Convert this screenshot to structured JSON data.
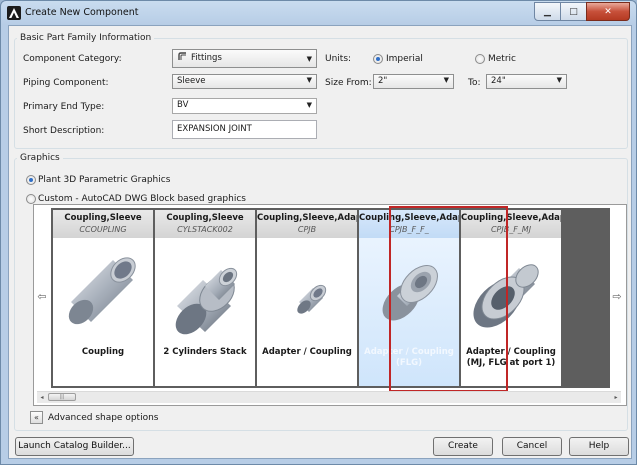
{
  "window": {
    "title": "Create New Component",
    "min_glyph": "▁",
    "max_glyph": "□",
    "close_glyph": "✕"
  },
  "basic_info": {
    "group_title": "Basic Part Family Information",
    "category_label": "Component Category:",
    "category_value": "Fittings",
    "units_label": "Units:",
    "unit_imperial": "Imperial",
    "unit_metric": "Metric",
    "units_selected": "Imperial",
    "piping_label": "Piping Component:",
    "piping_value": "Sleeve",
    "size_from_label": "Size From:",
    "size_from_value": "2\"",
    "to_label": "To:",
    "to_value": "24\"",
    "end_type_label": "Primary End Type:",
    "end_type_value": "BV",
    "short_desc_label": "Short Description:",
    "short_desc_value": "EXPANSION JOINT"
  },
  "graphics": {
    "group_title": "Graphics",
    "option_parametric": "Plant 3D Parametric Graphics",
    "option_custom": "Custom - AutoCAD DWG Block based graphics",
    "selected_option": "parametric",
    "cards": [
      {
        "family": "Coupling,Sleeve",
        "code": "CCOUPLING",
        "name": "Coupling",
        "shape": "coupling-cylinder-icon"
      },
      {
        "family": "Coupling,Sleeve",
        "code": "CYLSTACK002",
        "name": "2 Cylinders Stack",
        "shape": "cylinder-stack-icon"
      },
      {
        "family": "Coupling,Sleeve,Adapter",
        "code": "CPJB",
        "name": "Adapter / Coupling",
        "shape": "small-adapter-icon"
      },
      {
        "family": "Coupling,Sleeve,Adapter",
        "code": "CPJB_F_F_",
        "name": "Adapter / Coupling (FLG)",
        "shape": "flanged-adapter-icon"
      },
      {
        "family": "Coupling,Sleeve,Adapt",
        "code": "CPJB_F_MJ",
        "name": "Adapter / Coupling (MJ, FLG at port 1)",
        "shape": "flange-mj-adapter-icon"
      }
    ],
    "selected_card": 3,
    "advanced_label": "Advanced shape options"
  },
  "footer": {
    "launch_label": "Launch Catalog Builder...",
    "create_label": "Create",
    "cancel_label": "Cancel",
    "help_label": "Help"
  },
  "colors": {
    "selection_border": "#c02626",
    "radio_dot": "#2f6fc7",
    "title_bar": "#b7cde6"
  }
}
